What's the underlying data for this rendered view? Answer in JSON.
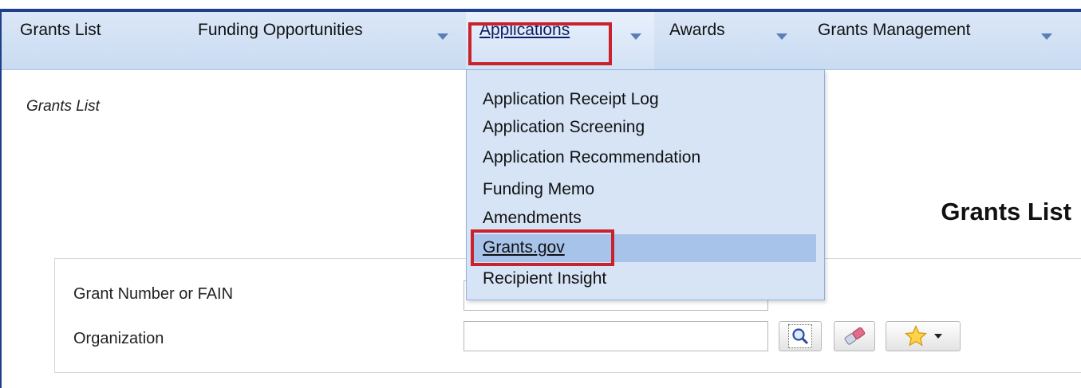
{
  "navbar": {
    "items": [
      {
        "label": "Grants List"
      },
      {
        "label": "Funding Opportunities"
      },
      {
        "label": "Applications"
      },
      {
        "label": "Awards"
      },
      {
        "label": "Grants Management"
      }
    ],
    "active": "Applications"
  },
  "dropdown": {
    "items": [
      {
        "label": "Application Receipt Log"
      },
      {
        "label": "Application Screening"
      },
      {
        "label": "Application Recommendation"
      },
      {
        "label": "Funding Memo"
      },
      {
        "label": "Amendments"
      },
      {
        "label": "Grants.gov"
      },
      {
        "label": "Recipient Insight"
      }
    ],
    "highlighted": "Grants.gov"
  },
  "breadcrumb": "Grants List",
  "page_title": "Grants List",
  "search": {
    "grant_number_label": "Grant Number or FAIN",
    "grant_number_value": "",
    "organization_label": "Organization",
    "organization_value": ""
  },
  "colors": {
    "nav_top_line": "#1f3f8a",
    "nav_bg": "#c9dbf2",
    "dropdown_bg": "#d6e4f6",
    "dropdown_highlight": "#a8c3ea",
    "annotation_red": "#c8232c"
  },
  "icons": {
    "lookup": "magnifier-icon",
    "clear": "eraser-icon",
    "favorites": "star-icon"
  }
}
